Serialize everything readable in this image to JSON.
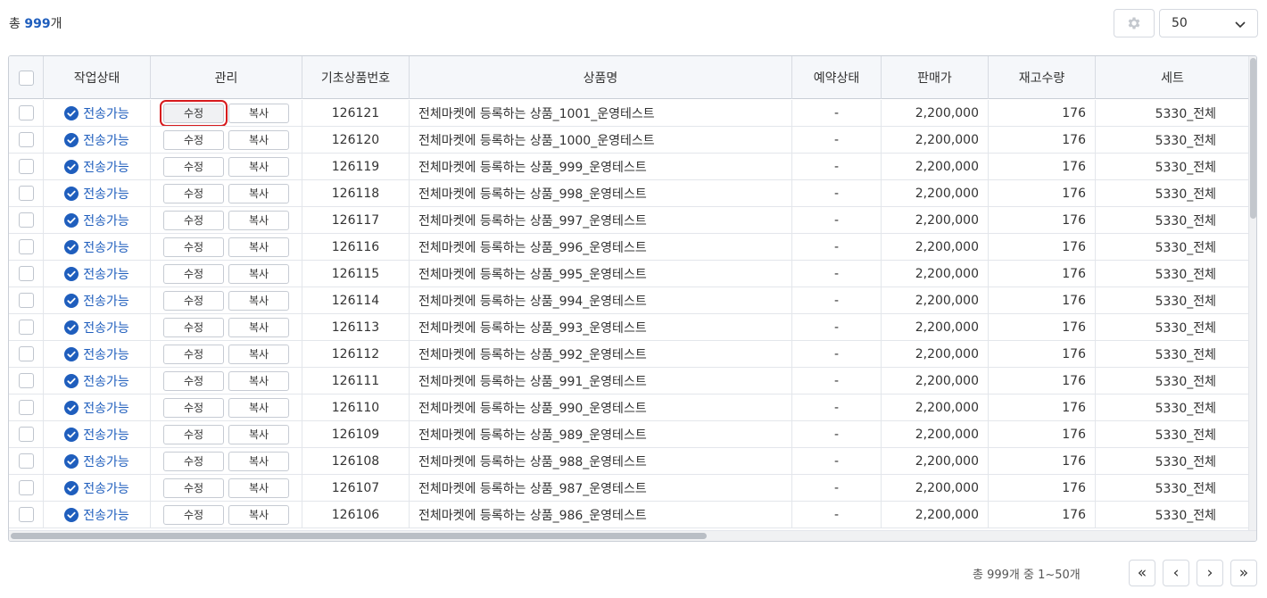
{
  "summary": {
    "prefix": "총",
    "count": "999",
    "suffix": "개"
  },
  "page_size": {
    "value": "50"
  },
  "headers": [
    "작업상태",
    "관리",
    "기초상품번호",
    "상품명",
    "예약상태",
    "판매가",
    "재고수량",
    "세트"
  ],
  "buttons": {
    "edit": "수정",
    "copy": "복사"
  },
  "rows": [
    {
      "status": "전송가능",
      "code": "126121",
      "name": "전체마켓에 등록하는 상품_1001_운영테스트",
      "reservation": "-",
      "price": "2,200,000",
      "stock": "176",
      "set": "5330_전체"
    },
    {
      "status": "전송가능",
      "code": "126120",
      "name": "전체마켓에 등록하는 상품_1000_운영테스트",
      "reservation": "-",
      "price": "2,200,000",
      "stock": "176",
      "set": "5330_전체"
    },
    {
      "status": "전송가능",
      "code": "126119",
      "name": "전체마켓에 등록하는 상품_999_운영테스트",
      "reservation": "-",
      "price": "2,200,000",
      "stock": "176",
      "set": "5330_전체"
    },
    {
      "status": "전송가능",
      "code": "126118",
      "name": "전체마켓에 등록하는 상품_998_운영테스트",
      "reservation": "-",
      "price": "2,200,000",
      "stock": "176",
      "set": "5330_전체"
    },
    {
      "status": "전송가능",
      "code": "126117",
      "name": "전체마켓에 등록하는 상품_997_운영테스트",
      "reservation": "-",
      "price": "2,200,000",
      "stock": "176",
      "set": "5330_전체"
    },
    {
      "status": "전송가능",
      "code": "126116",
      "name": "전체마켓에 등록하는 상품_996_운영테스트",
      "reservation": "-",
      "price": "2,200,000",
      "stock": "176",
      "set": "5330_전체"
    },
    {
      "status": "전송가능",
      "code": "126115",
      "name": "전체마켓에 등록하는 상품_995_운영테스트",
      "reservation": "-",
      "price": "2,200,000",
      "stock": "176",
      "set": "5330_전체"
    },
    {
      "status": "전송가능",
      "code": "126114",
      "name": "전체마켓에 등록하는 상품_994_운영테스트",
      "reservation": "-",
      "price": "2,200,000",
      "stock": "176",
      "set": "5330_전체"
    },
    {
      "status": "전송가능",
      "code": "126113",
      "name": "전체마켓에 등록하는 상품_993_운영테스트",
      "reservation": "-",
      "price": "2,200,000",
      "stock": "176",
      "set": "5330_전체"
    },
    {
      "status": "전송가능",
      "code": "126112",
      "name": "전체마켓에 등록하는 상품_992_운영테스트",
      "reservation": "-",
      "price": "2,200,000",
      "stock": "176",
      "set": "5330_전체"
    },
    {
      "status": "전송가능",
      "code": "126111",
      "name": "전체마켓에 등록하는 상품_991_운영테스트",
      "reservation": "-",
      "price": "2,200,000",
      "stock": "176",
      "set": "5330_전체"
    },
    {
      "status": "전송가능",
      "code": "126110",
      "name": "전체마켓에 등록하는 상품_990_운영테스트",
      "reservation": "-",
      "price": "2,200,000",
      "stock": "176",
      "set": "5330_전체"
    },
    {
      "status": "전송가능",
      "code": "126109",
      "name": "전체마켓에 등록하는 상품_989_운영테스트",
      "reservation": "-",
      "price": "2,200,000",
      "stock": "176",
      "set": "5330_전체"
    },
    {
      "status": "전송가능",
      "code": "126108",
      "name": "전체마켓에 등록하는 상품_988_운영테스트",
      "reservation": "-",
      "price": "2,200,000",
      "stock": "176",
      "set": "5330_전체"
    },
    {
      "status": "전송가능",
      "code": "126107",
      "name": "전체마켓에 등록하는 상품_987_운영테스트",
      "reservation": "-",
      "price": "2,200,000",
      "stock": "176",
      "set": "5330_전체"
    },
    {
      "status": "전송가능",
      "code": "126106",
      "name": "전체마켓에 등록하는 상품_986_운영테스트",
      "reservation": "-",
      "price": "2,200,000",
      "stock": "176",
      "set": "5330_전체"
    }
  ],
  "footer": {
    "summary": "총 999개 중 1~50개"
  },
  "pagination": [
    {
      "name": "first-page-button",
      "icon": "double-chevron-left-icon",
      "glyph": "«"
    },
    {
      "name": "prev-page-button",
      "icon": "chevron-left-icon",
      "glyph": "‹"
    },
    {
      "name": "next-page-button",
      "icon": "chevron-right-icon",
      "glyph": "›"
    },
    {
      "name": "last-page-button",
      "icon": "double-chevron-right-icon",
      "glyph": "»"
    }
  ],
  "icons": {
    "settings": "gear-icon",
    "status": "check-circle-icon",
    "dropdown": "chevron-down-icon"
  },
  "colors": {
    "accent": "#1f5ebd",
    "highlight": "#d7191c",
    "header_bg": "#f5f7fa"
  }
}
